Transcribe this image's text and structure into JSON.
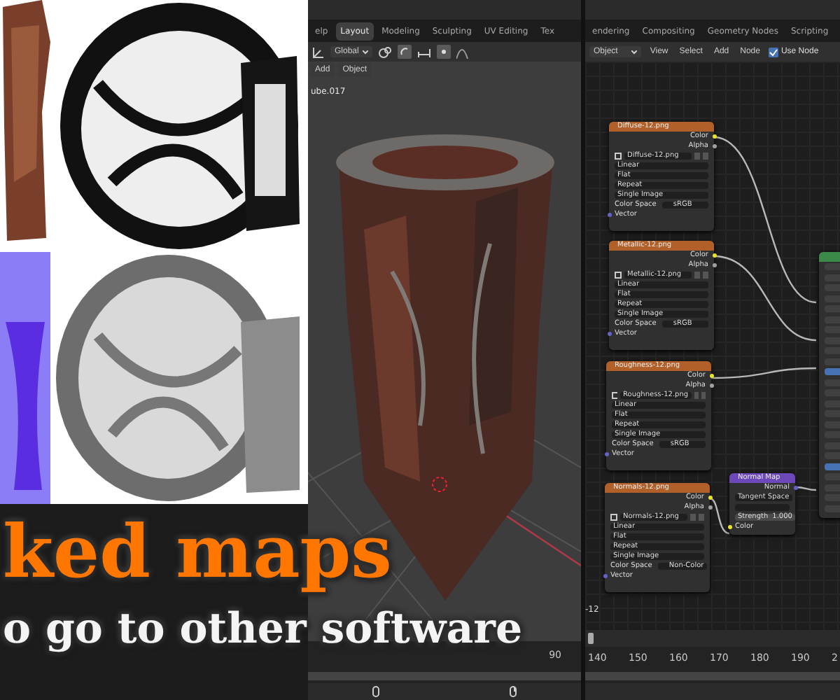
{
  "texture_panel": {
    "kind": "picture"
  },
  "viewport": {
    "tabs": [
      {
        "label": "elp",
        "selected": false
      },
      {
        "label": "Layout",
        "selected": true
      },
      {
        "label": "Modeling",
        "selected": false
      },
      {
        "label": "Sculpting",
        "selected": false
      },
      {
        "label": "UV Editing",
        "selected": false
      },
      {
        "label": "Tex",
        "selected": false
      }
    ],
    "orientation": "Global",
    "menu": [
      "Add",
      "Object"
    ],
    "object_name": "ube.017",
    "scene": {
      "kind": "picture"
    },
    "timeline_ticks": [
      "90"
    ]
  },
  "node_editor": {
    "tabs": [
      {
        "label": "endering",
        "selected": false
      },
      {
        "label": "Compositing",
        "selected": false
      },
      {
        "label": "Geometry Nodes",
        "selected": false
      },
      {
        "label": "Scripting",
        "selected": false
      }
    ],
    "mode": "Object",
    "menu": [
      "View",
      "Select",
      "Add",
      "Node"
    ],
    "use_nodes": {
      "label": "Use Node",
      "checked": true
    },
    "nodes": [
      {
        "kind": "image_texture",
        "title": "Diffuse-12.png",
        "outputs": [
          "Color",
          "Alpha"
        ],
        "image": "Diffuse-12.png",
        "options": [
          "Linear",
          "Flat",
          "Repeat",
          "Single Image"
        ],
        "color_space_label": "Color Space",
        "color_space": "sRGB",
        "input": "Vector"
      },
      {
        "kind": "image_texture",
        "title": "Metallic-12.png",
        "outputs": [
          "Color",
          "Alpha"
        ],
        "image": "Metallic-12.png",
        "options": [
          "Linear",
          "Flat",
          "Repeat",
          "Single Image"
        ],
        "color_space_label": "Color Space",
        "color_space": "sRGB",
        "input": "Vector"
      },
      {
        "kind": "image_texture",
        "title": "Roughness-12.png",
        "outputs": [
          "Color",
          "Alpha"
        ],
        "image": "Roughness-12.png",
        "options": [
          "Linear",
          "Flat",
          "Repeat",
          "Single Image"
        ],
        "color_space_label": "Color Space",
        "color_space": "sRGB",
        "input": "Vector"
      },
      {
        "kind": "image_texture",
        "title": "Normals-12.png",
        "outputs": [
          "Color",
          "Alpha"
        ],
        "image": "Normals-12.png",
        "options": [
          "Linear",
          "Flat",
          "Repeat",
          "Single Image"
        ],
        "color_space_label": "Color Space",
        "color_space": "Non-Color",
        "input": "Vector"
      },
      {
        "kind": "normal_map",
        "title": "Normal Map",
        "output": "Normal",
        "space": "Tangent Space",
        "strength_label": "Strength",
        "strength": "1.000",
        "input": "Color"
      },
      {
        "kind": "shader"
      }
    ],
    "frame_label": "-12",
    "timeline_ticks": [
      "140",
      "150",
      "160",
      "170",
      "180",
      "190",
      "2"
    ]
  },
  "title_overlay": {
    "headline": "ked maps",
    "subtitle": "o go to other software"
  }
}
